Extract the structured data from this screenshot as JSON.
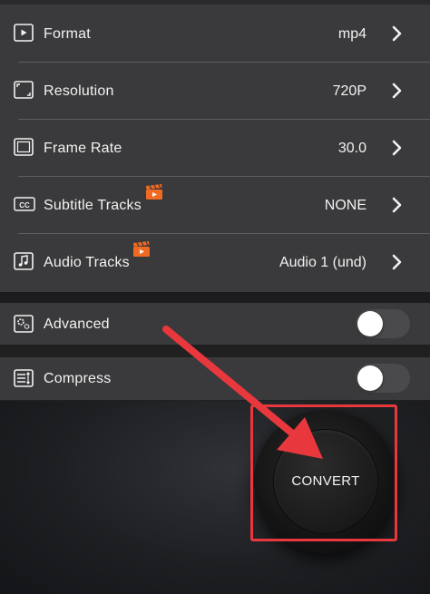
{
  "settings": {
    "rows": [
      {
        "id": "format",
        "label": "Format",
        "value": "mp4",
        "icon": "video-file-icon",
        "pro": false
      },
      {
        "id": "resolution",
        "label": "Resolution",
        "value": "720P",
        "icon": "resolution-frame-icon",
        "pro": false
      },
      {
        "id": "frame-rate",
        "label": "Frame Rate",
        "value": "30.0",
        "icon": "film-frame-icon",
        "pro": false
      },
      {
        "id": "subtitle-tracks",
        "label": "Subtitle Tracks",
        "value": "NONE",
        "icon": "closed-caption-icon",
        "pro": true
      },
      {
        "id": "audio-tracks",
        "label": "Audio Tracks",
        "value": "Audio 1 (und)",
        "icon": "music-note-icon",
        "pro": true
      }
    ]
  },
  "toggles": [
    {
      "id": "advanced",
      "label": "Advanced",
      "icon": "gears-icon",
      "on": false
    },
    {
      "id": "compress",
      "label": "Compress",
      "icon": "compress-sliders-icon",
      "on": false
    }
  ],
  "convert": {
    "label": "CONVERT"
  },
  "colors": {
    "panel": "#3a3a3c",
    "annotation": "#e8383d",
    "pro_badge": "#f06a22"
  }
}
